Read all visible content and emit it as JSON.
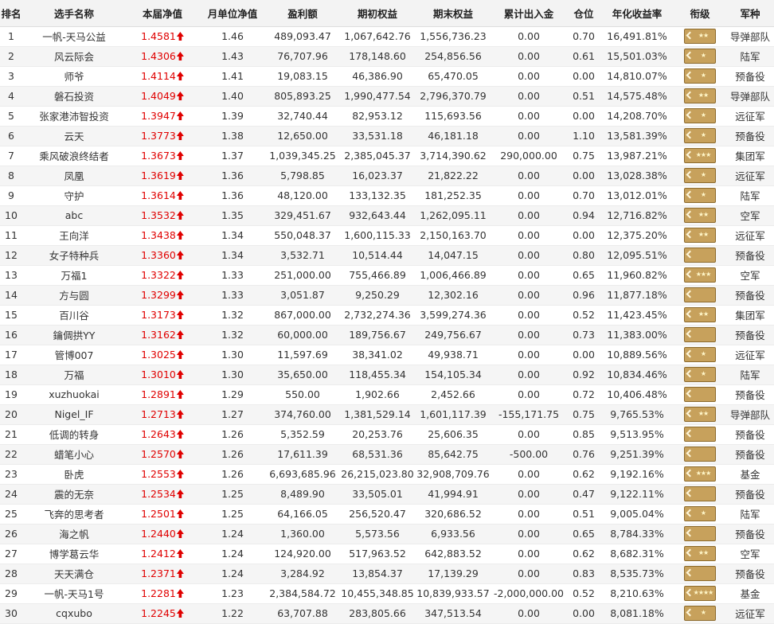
{
  "columns": [
    "排名",
    "选手名称",
    "本届净值",
    "月单位净值",
    "盈利额",
    "期初权益",
    "期末权益",
    "累计出入金",
    "仓位",
    "年化收益率",
    "衔级",
    "军种"
  ],
  "rows": [
    {
      "rank": "1",
      "name": "一帆-天马公益",
      "nav": "1.4581",
      "monthly_nav": "1.46",
      "profit": "489,093.47",
      "initial_equity": "1,067,642.76",
      "final_equity": "1,556,736.23",
      "net_deposit": "0.00",
      "position": "0.70",
      "annual_return": "16,491.81%",
      "insignia_stars": 2,
      "branch": "导弹部队"
    },
    {
      "rank": "2",
      "name": "风云际会",
      "nav": "1.4306",
      "monthly_nav": "1.43",
      "profit": "76,707.96",
      "initial_equity": "178,148.60",
      "final_equity": "254,856.56",
      "net_deposit": "0.00",
      "position": "0.61",
      "annual_return": "15,501.03%",
      "insignia_stars": 1,
      "branch": "陆军"
    },
    {
      "rank": "3",
      "name": "师爷",
      "nav": "1.4114",
      "monthly_nav": "1.41",
      "profit": "19,083.15",
      "initial_equity": "46,386.90",
      "final_equity": "65,470.05",
      "net_deposit": "0.00",
      "position": "0.00",
      "annual_return": "14,810.07%",
      "insignia_stars": 1,
      "branch": "预备役"
    },
    {
      "rank": "4",
      "name": "磐石投资",
      "nav": "1.4049",
      "monthly_nav": "1.40",
      "profit": "805,893.25",
      "initial_equity": "1,990,477.54",
      "final_equity": "2,796,370.79",
      "net_deposit": "0.00",
      "position": "0.51",
      "annual_return": "14,575.48%",
      "insignia_stars": 2,
      "branch": "导弹部队"
    },
    {
      "rank": "5",
      "name": "张家港沛智投资",
      "nav": "1.3947",
      "monthly_nav": "1.39",
      "profit": "32,740.44",
      "initial_equity": "82,953.12",
      "final_equity": "115,693.56",
      "net_deposit": "0.00",
      "position": "0.00",
      "annual_return": "14,208.70%",
      "insignia_stars": 1,
      "branch": "远征军"
    },
    {
      "rank": "6",
      "name": "云天",
      "nav": "1.3773",
      "monthly_nav": "1.38",
      "profit": "12,650.00",
      "initial_equity": "33,531.18",
      "final_equity": "46,181.18",
      "net_deposit": "0.00",
      "position": "1.10",
      "annual_return": "13,581.39%",
      "insignia_stars": 1,
      "branch": "预备役"
    },
    {
      "rank": "7",
      "name": "乘风破浪终结者",
      "nav": "1.3673",
      "monthly_nav": "1.37",
      "profit": "1,039,345.25",
      "initial_equity": "2,385,045.37",
      "final_equity": "3,714,390.62",
      "net_deposit": "290,000.00",
      "position": "0.75",
      "annual_return": "13,987.21%",
      "insignia_stars": 3,
      "branch": "集团军"
    },
    {
      "rank": "8",
      "name": "凤凰",
      "nav": "1.3619",
      "monthly_nav": "1.36",
      "profit": "5,798.85",
      "initial_equity": "16,023.37",
      "final_equity": "21,822.22",
      "net_deposit": "0.00",
      "position": "0.00",
      "annual_return": "13,028.38%",
      "insignia_stars": 1,
      "branch": "远征军"
    },
    {
      "rank": "9",
      "name": "守护",
      "nav": "1.3614",
      "monthly_nav": "1.36",
      "profit": "48,120.00",
      "initial_equity": "133,132.35",
      "final_equity": "181,252.35",
      "net_deposit": "0.00",
      "position": "0.70",
      "annual_return": "13,012.01%",
      "insignia_stars": 1,
      "branch": "陆军"
    },
    {
      "rank": "10",
      "name": "abc",
      "nav": "1.3532",
      "monthly_nav": "1.35",
      "profit": "329,451.67",
      "initial_equity": "932,643.44",
      "final_equity": "1,262,095.11",
      "net_deposit": "0.00",
      "position": "0.94",
      "annual_return": "12,716.82%",
      "insignia_stars": 2,
      "branch": "空军"
    },
    {
      "rank": "11",
      "name": "王向洋",
      "nav": "1.3438",
      "monthly_nav": "1.34",
      "profit": "550,048.37",
      "initial_equity": "1,600,115.33",
      "final_equity": "2,150,163.70",
      "net_deposit": "0.00",
      "position": "0.00",
      "annual_return": "12,375.20%",
      "insignia_stars": 2,
      "branch": "远征军"
    },
    {
      "rank": "12",
      "name": "女子特种兵",
      "nav": "1.3360",
      "monthly_nav": "1.34",
      "profit": "3,532.71",
      "initial_equity": "10,514.44",
      "final_equity": "14,047.15",
      "net_deposit": "0.00",
      "position": "0.80",
      "annual_return": "12,095.51%",
      "insignia_stars": 0,
      "branch": "预备役"
    },
    {
      "rank": "13",
      "name": "万福1",
      "nav": "1.3322",
      "monthly_nav": "1.33",
      "profit": "251,000.00",
      "initial_equity": "755,466.89",
      "final_equity": "1,006,466.89",
      "net_deposit": "0.00",
      "position": "0.65",
      "annual_return": "11,960.82%",
      "insignia_stars": 3,
      "branch": "空军"
    },
    {
      "rank": "14",
      "name": "方与圆",
      "nav": "1.3299",
      "monthly_nav": "1.33",
      "profit": "3,051.87",
      "initial_equity": "9,250.29",
      "final_equity": "12,302.16",
      "net_deposit": "0.00",
      "position": "0.96",
      "annual_return": "11,877.18%",
      "insignia_stars": 0,
      "branch": "预备役"
    },
    {
      "rank": "15",
      "name": "百川谷",
      "nav": "1.3173",
      "monthly_nav": "1.32",
      "profit": "867,000.00",
      "initial_equity": "2,732,274.36",
      "final_equity": "3,599,274.36",
      "net_deposit": "0.00",
      "position": "0.52",
      "annual_return": "11,423.45%",
      "insignia_stars": 2,
      "branch": "集团军"
    },
    {
      "rank": "16",
      "name": "鑰倜拱YY",
      "nav": "1.3162",
      "monthly_nav": "1.32",
      "profit": "60,000.00",
      "initial_equity": "189,756.67",
      "final_equity": "249,756.67",
      "net_deposit": "0.00",
      "position": "0.73",
      "annual_return": "11,383.00%",
      "insignia_stars": 0,
      "branch": "预备役"
    },
    {
      "rank": "17",
      "name": "管博007",
      "nav": "1.3025",
      "monthly_nav": "1.30",
      "profit": "11,597.69",
      "initial_equity": "38,341.02",
      "final_equity": "49,938.71",
      "net_deposit": "0.00",
      "position": "0.00",
      "annual_return": "10,889.56%",
      "insignia_stars": 1,
      "branch": "远征军"
    },
    {
      "rank": "18",
      "name": "万福",
      "nav": "1.3010",
      "monthly_nav": "1.30",
      "profit": "35,650.00",
      "initial_equity": "118,455.34",
      "final_equity": "154,105.34",
      "net_deposit": "0.00",
      "position": "0.92",
      "annual_return": "10,834.46%",
      "insignia_stars": 1,
      "branch": "陆军"
    },
    {
      "rank": "19",
      "name": "xuzhuokai",
      "nav": "1.2891",
      "monthly_nav": "1.29",
      "profit": "550.00",
      "initial_equity": "1,902.66",
      "final_equity": "2,452.66",
      "net_deposit": "0.00",
      "position": "0.72",
      "annual_return": "10,406.48%",
      "insignia_stars": 0,
      "branch": "预备役"
    },
    {
      "rank": "20",
      "name": "Nigel_IF",
      "nav": "1.2713",
      "monthly_nav": "1.27",
      "profit": "374,760.00",
      "initial_equity": "1,381,529.14",
      "final_equity": "1,601,117.39",
      "net_deposit": "-155,171.75",
      "position": "0.75",
      "annual_return": "9,765.53%",
      "insignia_stars": 2,
      "branch": "导弹部队"
    },
    {
      "rank": "21",
      "name": "低调的转身",
      "nav": "1.2643",
      "monthly_nav": "1.26",
      "profit": "5,352.59",
      "initial_equity": "20,253.76",
      "final_equity": "25,606.35",
      "net_deposit": "0.00",
      "position": "0.85",
      "annual_return": "9,513.95%",
      "insignia_stars": 0,
      "branch": "预备役"
    },
    {
      "rank": "22",
      "name": "蜡笔小心",
      "nav": "1.2570",
      "monthly_nav": "1.26",
      "profit": "17,611.39",
      "initial_equity": "68,531.36",
      "final_equity": "85,642.75",
      "net_deposit": "-500.00",
      "position": "0.76",
      "annual_return": "9,251.39%",
      "insignia_stars": 0,
      "branch": "预备役"
    },
    {
      "rank": "23",
      "name": "卧虎",
      "nav": "1.2553",
      "monthly_nav": "1.26",
      "profit": "6,693,685.96",
      "initial_equity": "26,215,023.80",
      "final_equity": "32,908,709.76",
      "net_deposit": "0.00",
      "position": "0.62",
      "annual_return": "9,192.16%",
      "insignia_stars": 3,
      "branch": "基金"
    },
    {
      "rank": "24",
      "name": "震的无奈",
      "nav": "1.2534",
      "monthly_nav": "1.25",
      "profit": "8,489.90",
      "initial_equity": "33,505.01",
      "final_equity": "41,994.91",
      "net_deposit": "0.00",
      "position": "0.47",
      "annual_return": "9,122.11%",
      "insignia_stars": 0,
      "branch": "预备役"
    },
    {
      "rank": "25",
      "name": "飞奔的思考者",
      "nav": "1.2501",
      "monthly_nav": "1.25",
      "profit": "64,166.05",
      "initial_equity": "256,520.47",
      "final_equity": "320,686.52",
      "net_deposit": "0.00",
      "position": "0.51",
      "annual_return": "9,005.04%",
      "insignia_stars": 1,
      "branch": "陆军"
    },
    {
      "rank": "26",
      "name": "海之帆",
      "nav": "1.2440",
      "monthly_nav": "1.24",
      "profit": "1,360.00",
      "initial_equity": "5,573.56",
      "final_equity": "6,933.56",
      "net_deposit": "0.00",
      "position": "0.65",
      "annual_return": "8,784.33%",
      "insignia_stars": 0,
      "branch": "预备役"
    },
    {
      "rank": "27",
      "name": "博学葛云华",
      "nav": "1.2412",
      "monthly_nav": "1.24",
      "profit": "124,920.00",
      "initial_equity": "517,963.52",
      "final_equity": "642,883.52",
      "net_deposit": "0.00",
      "position": "0.62",
      "annual_return": "8,682.31%",
      "insignia_stars": 2,
      "branch": "空军"
    },
    {
      "rank": "28",
      "name": "天天满仓",
      "nav": "1.2371",
      "monthly_nav": "1.24",
      "profit": "3,284.92",
      "initial_equity": "13,854.37",
      "final_equity": "17,139.29",
      "net_deposit": "0.00",
      "position": "0.83",
      "annual_return": "8,535.73%",
      "insignia_stars": 0,
      "branch": "预备役"
    },
    {
      "rank": "29",
      "name": "一帆-天马1号",
      "nav": "1.2281",
      "monthly_nav": "1.23",
      "profit": "2,384,584.72",
      "initial_equity": "10,455,348.85",
      "final_equity": "10,839,933.57",
      "net_deposit": "-2,000,000.00",
      "position": "0.52",
      "annual_return": "8,210.63%",
      "insignia_stars": 4,
      "branch": "基金"
    },
    {
      "rank": "30",
      "name": "cqxubo",
      "nav": "1.2245",
      "monthly_nav": "1.22",
      "profit": "63,707.88",
      "initial_equity": "283,805.66",
      "final_equity": "347,513.54",
      "net_deposit": "0.00",
      "position": "0.00",
      "annual_return": "8,081.18%",
      "insignia_stars": 1,
      "branch": "远征军"
    }
  ],
  "icons": {
    "nav_trend": "up-arrow-icon",
    "insignia": "rank-insignia-icon"
  },
  "colors": {
    "nav_text": "#e00000",
    "insignia_gold": "#c7a15c",
    "header_bg": "#f3f3f3",
    "alt_row_bg": "#f5f5f5"
  }
}
